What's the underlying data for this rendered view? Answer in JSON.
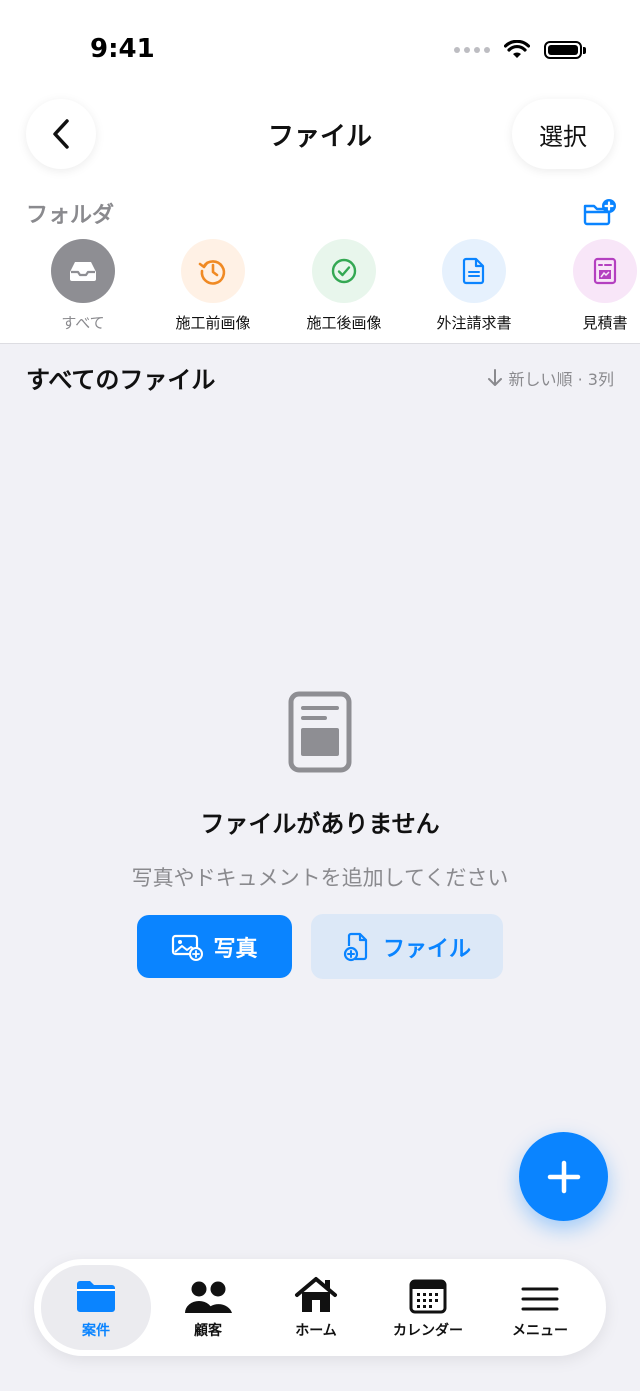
{
  "status": {
    "time": "9:41"
  },
  "nav": {
    "back_icon": "chevron-left-icon",
    "title": "ファイル",
    "select_label": "選択"
  },
  "folders": {
    "label": "フォルダ",
    "new_folder_icon": "folder-plus-icon",
    "items": [
      {
        "label": "すべて",
        "icon": "tray-icon",
        "bg": "#8E8E93",
        "fg": "#FFFFFF",
        "selected": true
      },
      {
        "label": "施工前画像",
        "icon": "clock-history-icon",
        "bg": "#FFF1E5",
        "fg": "#F08A24"
      },
      {
        "label": "施工後画像",
        "icon": "checkmark-circle-icon",
        "bg": "#E8F6EC",
        "fg": "#34A853"
      },
      {
        "label": "外注請求書",
        "icon": "document-icon",
        "bg": "#E6F1FD",
        "fg": "#0A84FF"
      },
      {
        "label": "見積書",
        "icon": "estimate-icon",
        "bg": "#F8E6F8",
        "fg": "#B440C0"
      }
    ]
  },
  "files": {
    "title": "すべてのファイル",
    "sort_label": "新しい順 · 3列"
  },
  "empty": {
    "title": "ファイルがありません",
    "subtitle": "写真やドキュメントを追加してください",
    "photo_button": "写真",
    "file_button": "ファイル"
  },
  "tabs": [
    {
      "label": "案件",
      "icon": "folder-icon",
      "active": true
    },
    {
      "label": "顧客",
      "icon": "people-icon"
    },
    {
      "label": "ホーム",
      "icon": "house-icon"
    },
    {
      "label": "カレンダー",
      "icon": "calendar-icon"
    },
    {
      "label": "メニュー",
      "icon": "menu-icon"
    }
  ],
  "colors": {
    "accent": "#0A84FF",
    "background": "#F1F1F6",
    "muted": "#8A8A8E"
  }
}
